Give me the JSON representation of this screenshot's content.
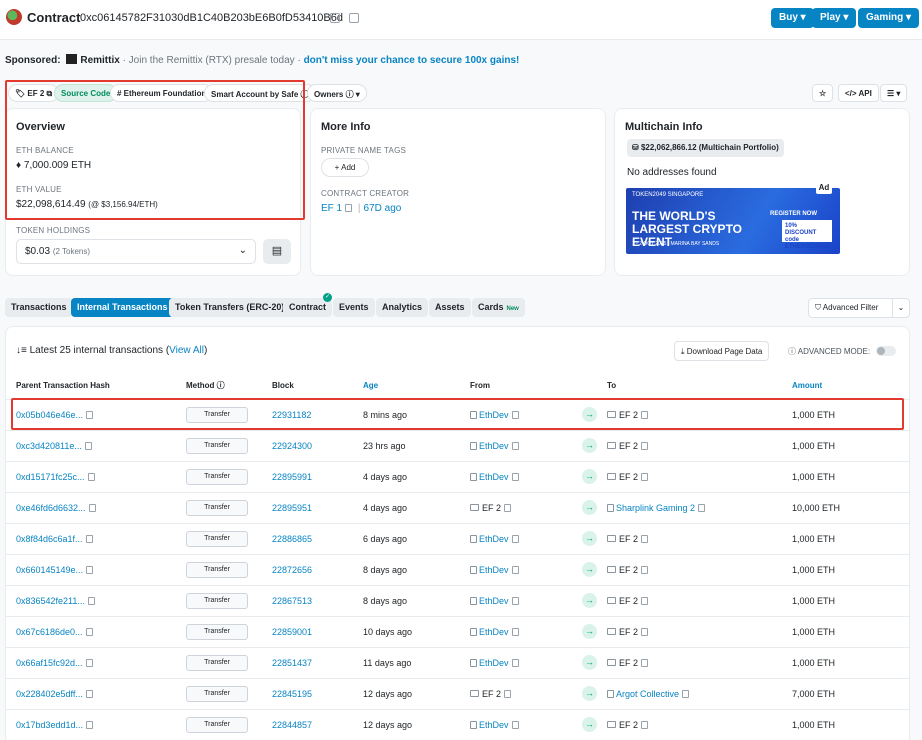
{
  "header": {
    "title": "Contract",
    "address": "0xc06145782F31030dB1C40B203bE6B0fD53410B6d",
    "buttons": [
      "Buy",
      "Play",
      "Gaming"
    ]
  },
  "sponsor": {
    "label": "Sponsored:",
    "brand": "Remittix",
    "text": " · Join the Remittix (RTX) presale today · ",
    "cta": "don't miss your chance to secure 100x gains!"
  },
  "tags": {
    "ef2": "EF 2",
    "source_code": "Source Code",
    "eth_foundation": "# Ethereum Foundation",
    "smart_account": "Smart Account by Safe",
    "owners": "Owners",
    "api": "API"
  },
  "overview": {
    "title": "Overview",
    "eth_balance_label": "ETH BALANCE",
    "eth_balance": "7,000.009 ETH",
    "eth_value_label": "ETH VALUE",
    "eth_value": "$22,098,614.49",
    "eth_price": "(@ $3,156.94/ETH)",
    "token_holdings_label": "TOKEN HOLDINGS",
    "token_value": "$0.03",
    "token_count": "(2 Tokens)"
  },
  "more_info": {
    "title": "More Info",
    "private_tags_label": "PRIVATE NAME TAGS",
    "add_label": "+ Add",
    "creator_label": "CONTRACT CREATOR",
    "creator": "EF 1",
    "creator_age": "67D ago"
  },
  "multichain": {
    "title": "Multichain Info",
    "portfolio": "$22,062,866.12 (Multichain Portfolio)",
    "no_addresses": "No addresses found",
    "ad_tag": "Ad",
    "ad_brand": "TOKEN2049 SINGAPORE",
    "ad_headline": "THE WORLD'S LARGEST CRYPTO EVENT",
    "ad_date": "1 - 2 OCT 2025 | MARINA BAY SANDS",
    "ad_register": "REGISTER NOW",
    "ad_discount": "10% DISCOUNT code ETHERSCAN10"
  },
  "tabs": [
    "Transactions",
    "Internal Transactions",
    "Token Transfers (ERC-20)",
    "Contract",
    "Events",
    "Analytics",
    "Assets",
    "Cards"
  ],
  "cards_badge": "New",
  "advanced_filter": "Advanced Filter",
  "list": {
    "summary": "Latest 25 internal transactions (",
    "view_all": "View All",
    "summary_end": ")",
    "download": "Download Page Data",
    "advanced_mode": "ADVANCED MODE:"
  },
  "table": {
    "headers": [
      "Parent Transaction Hash",
      "Method",
      "Block",
      "Age",
      "From",
      "",
      "To",
      "Amount"
    ],
    "rows": [
      {
        "hash": "0x05b046e46e...",
        "method": "Transfer",
        "block": "22931182",
        "age": "8 mins ago",
        "from": "EthDev",
        "to": "EF 2",
        "amount": "1,000 ETH"
      },
      {
        "hash": "0xc3d420811e...",
        "method": "Transfer",
        "block": "22924300",
        "age": "23 hrs ago",
        "from": "EthDev",
        "to": "EF 2",
        "amount": "1,000 ETH"
      },
      {
        "hash": "0xd15171fc25c...",
        "method": "Transfer",
        "block": "22895991",
        "age": "4 days ago",
        "from": "EthDev",
        "to": "EF 2",
        "amount": "1,000 ETH"
      },
      {
        "hash": "0xe46fd6d6632...",
        "method": "Transfer",
        "block": "22895951",
        "age": "4 days ago",
        "from": "EF 2",
        "to": "Sharplink Gaming 2",
        "amount": "10,000 ETH"
      },
      {
        "hash": "0x8f84d6c6a1f...",
        "method": "Transfer",
        "block": "22886865",
        "age": "6 days ago",
        "from": "EthDev",
        "to": "EF 2",
        "amount": "1,000 ETH"
      },
      {
        "hash": "0x660145149e...",
        "method": "Transfer",
        "block": "22872656",
        "age": "8 days ago",
        "from": "EthDev",
        "to": "EF 2",
        "amount": "1,000 ETH"
      },
      {
        "hash": "0x836542fe211...",
        "method": "Transfer",
        "block": "22867513",
        "age": "8 days ago",
        "from": "EthDev",
        "to": "EF 2",
        "amount": "1,000 ETH"
      },
      {
        "hash": "0x67c6186de0...",
        "method": "Transfer",
        "block": "22859001",
        "age": "10 days ago",
        "from": "EthDev",
        "to": "EF 2",
        "amount": "1,000 ETH"
      },
      {
        "hash": "0x66af15fc92d...",
        "method": "Transfer",
        "block": "22851437",
        "age": "11 days ago",
        "from": "EthDev",
        "to": "EF 2",
        "amount": "1,000 ETH"
      },
      {
        "hash": "0x228402e5dff...",
        "method": "Transfer",
        "block": "22845195",
        "age": "12 days ago",
        "from": "EF 2",
        "to": "Argot Collective",
        "amount": "7,000 ETH"
      },
      {
        "hash": "0x17bd3edd1d...",
        "method": "Transfer",
        "block": "22844857",
        "age": "12 days ago",
        "from": "EthDev",
        "to": "EF 2",
        "amount": "1,000 ETH"
      }
    ]
  },
  "colors": {
    "accent": "#0784c3",
    "highlight": "#e23a2e",
    "success": "#008c5a"
  }
}
